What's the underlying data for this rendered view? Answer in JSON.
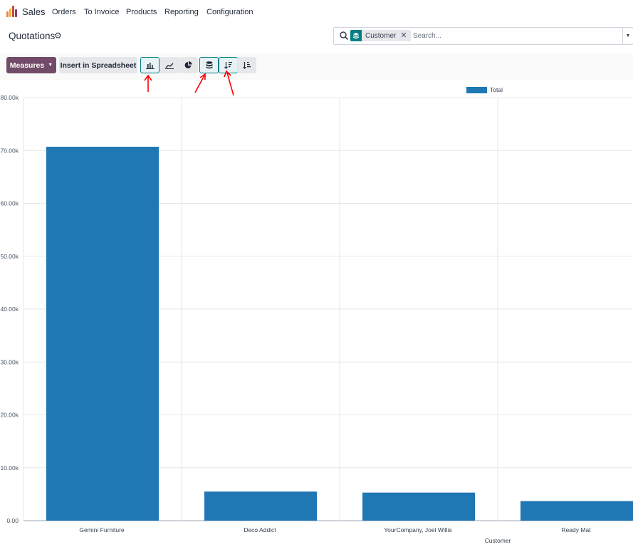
{
  "navbar": {
    "app_name": "Sales",
    "menu": [
      "Orders",
      "To Invoice",
      "Products",
      "Reporting",
      "Configuration"
    ]
  },
  "control_panel": {
    "title": "Quotations",
    "search": {
      "facet_label": "Customer",
      "placeholder": "Search..."
    }
  },
  "toolbar": {
    "measures_label": "Measures",
    "spreadsheet_label": "Insert in Spreadsheet",
    "chart_type_buttons": [
      "bar-chart-icon",
      "line-chart-icon",
      "pie-chart-icon"
    ],
    "option_buttons": [
      "stacked-icon",
      "sort-descending-icon",
      "sort-ascending-icon"
    ],
    "active": [
      "bar-chart-icon",
      "stacked-icon",
      "sort-descending-icon"
    ]
  },
  "chart_data": {
    "type": "bar",
    "categories": [
      "Gemini Furniture",
      "Deco Addict",
      "YourCompany, Joel Willis",
      "Ready Mat"
    ],
    "series": [
      {
        "name": "Total",
        "values": [
          70700,
          5500,
          5300,
          3700
        ],
        "color": "#1f77b4"
      }
    ],
    "ylim": [
      0,
      80000
    ],
    "yticks": [
      "0.00",
      "10.00k",
      "20.00k",
      "30.00k",
      "40.00k",
      "50.00k",
      "60.00k",
      "70.00k",
      "80.00k"
    ],
    "xlabel": "Customer",
    "ylabel": "",
    "grid": true,
    "legend_position": "top"
  },
  "colors": {
    "primary": "#714b67",
    "accent": "#017e84",
    "bar": "#1f77b4",
    "annotation_arrow": "#ff0000"
  }
}
